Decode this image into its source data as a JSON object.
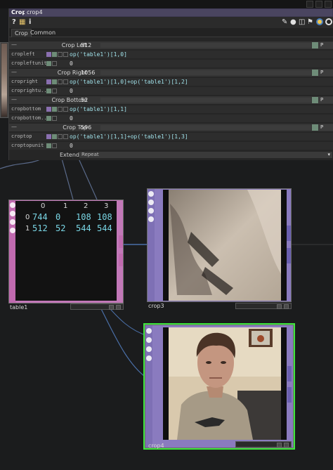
{
  "panel": {
    "op_type": "Crop",
    "op_name": "crop4",
    "toolbar_icons": [
      "help-icon",
      "python-icon",
      "info-icon"
    ],
    "right_icons": [
      "edit-icon",
      "comment-icon",
      "copy-icon",
      "bookmark-icon",
      "python-logo-icon",
      "viewer-icon"
    ],
    "tabs": [
      "Crop",
      "Common"
    ],
    "params": {
      "crop_left_label": "Crop Left",
      "crop_left_value": "512",
      "cropleft_name": "cropleft",
      "cropleft_expr": "op('table1')[1,0]",
      "cropleftunit_name": "cropleftunit",
      "cropleftunit_value": "0",
      "crop_right_label": "Crop Right",
      "crop_right_value": "1056",
      "cropright_name": "cropright",
      "cropright_expr": "op('table1')[1,0]+op('table1')[1,2]",
      "croprightunit_name": "croprightu...",
      "croprightunit_value": "0",
      "crop_bottom_label": "Crop Bottom",
      "crop_bottom_value": "52",
      "cropbottom_name": "cropbottom",
      "cropbottom_expr": "op('table1')[1,1]",
      "cropbottomunit_name": "cropbottom...",
      "cropbottomunit_value": "0",
      "crop_top_label": "Crop Top",
      "crop_top_value": "596",
      "croptop_name": "croptop",
      "croptop_expr": "op('table1')[1,1]+op('table1')[1,3]",
      "croptopunit_name": "croptopunit",
      "croptopunit_value": "0",
      "mode_label": "P",
      "extend_label": "Extend",
      "extend_value": "Repeat"
    }
  },
  "table1": {
    "name": "table1",
    "col_headers": [
      "0",
      "1",
      "2",
      "3"
    ],
    "row_headers": [
      "0",
      "1"
    ],
    "rows": [
      [
        "744",
        "0",
        "108",
        "108"
      ],
      [
        "512",
        "52",
        "544",
        "544"
      ]
    ]
  },
  "crop3": {
    "name": "crop3"
  },
  "crop4": {
    "name": "crop4"
  },
  "colors": {
    "selected": "#3ee63e",
    "dat_color": "#c278b8",
    "top_color": "#8a7bbf",
    "expr_color": "#9fe0e8"
  }
}
